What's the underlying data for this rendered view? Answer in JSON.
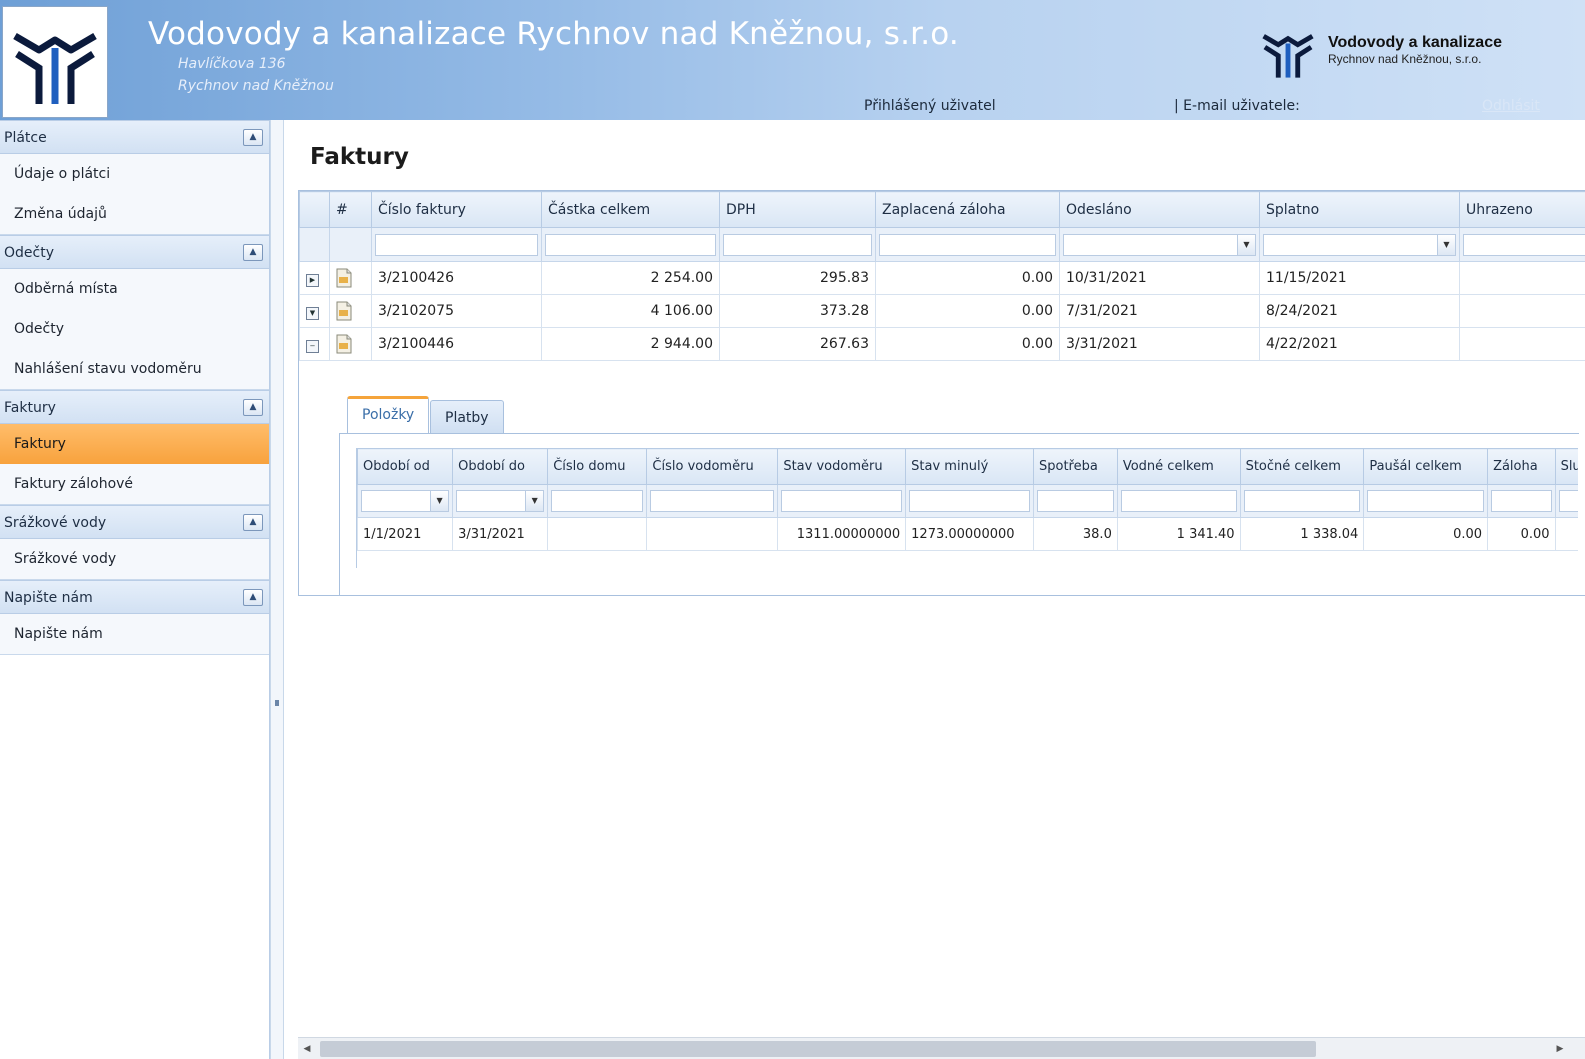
{
  "header": {
    "company_title": "Vodovody a kanalizace Rychnov nad Kněžnou, s.r.o.",
    "address_line1": "Havlíčkova 136",
    "address_line2": "Rychnov nad Kněžnou",
    "brand_name": "Vodovody a kanalizace",
    "brand_sub": "Rychnov nad Kněžnou, s.r.o.",
    "logged_user_label": "Přihlášený uživatel",
    "email_label": "| E-mail uživatele:",
    "logout_label": "Odhlásit",
    "logo_icon": "vak-logo-icon"
  },
  "sidebar": {
    "groups": [
      {
        "title": "Plátce",
        "items": [
          "Údaje o plátci",
          "Změna údajů"
        ]
      },
      {
        "title": "Odečty",
        "items": [
          "Odběrná místa",
          "Odečty",
          "Nahlášení stavu vodoměru"
        ]
      },
      {
        "title": "Faktury",
        "items": [
          "Faktury",
          "Faktury zálohové"
        ]
      },
      {
        "title": "Srážkové vody",
        "items": [
          "Srážkové vody"
        ]
      },
      {
        "title": "Napište nám",
        "items": [
          "Napište nám"
        ]
      }
    ],
    "active_item": "Faktury"
  },
  "main": {
    "title": "Faktury",
    "grid": {
      "columns": [
        "#",
        "Číslo faktury",
        "Částka celkem",
        "DPH",
        "Zaplacená záloha",
        "Odesláno",
        "Splatno",
        "Uhrazeno"
      ],
      "rows": [
        {
          "cislo": "3/2100426",
          "castka": "2 254.00",
          "dph": "295.83",
          "zaloha": "0.00",
          "odeslano": "10/31/2021",
          "splatno": "11/15/2021",
          "uhrazeno": ""
        },
        {
          "cislo": "3/2102075",
          "castka": "4 106.00",
          "dph": "373.28",
          "zaloha": "0.00",
          "odeslano": "7/31/2021",
          "splatno": "8/24/2021",
          "uhrazeno": ""
        },
        {
          "cislo": "3/2100446",
          "castka": "2 944.00",
          "dph": "267.63",
          "zaloha": "0.00",
          "odeslano": "3/31/2021",
          "splatno": "4/22/2021",
          "uhrazeno": ""
        }
      ]
    },
    "detail": {
      "tabs": [
        "Položky",
        "Platby"
      ],
      "active_tab": "Položky",
      "columns": [
        "Období od",
        "Období do",
        "Číslo domu",
        "Číslo vodoměru",
        "Stav vodoměru",
        "Stav minulý",
        "Spotřeba",
        "Vodné celkem",
        "Stočné celkem",
        "Paušál celkem",
        "Záloha",
        "Služ"
      ],
      "rows": [
        [
          "1/1/2021",
          "3/31/2021",
          "",
          "",
          "1311.00000000",
          "1273.00000000",
          "38.0",
          "1 341.40",
          "1 338.04",
          "0.00",
          "0.00",
          ""
        ]
      ]
    }
  },
  "colors": {
    "header_gradient_start": "#6e9fd6",
    "active_nav": "#f8a23d",
    "grid_header": "#d9e6f5",
    "active_tab_accent": "#f5a43b"
  }
}
